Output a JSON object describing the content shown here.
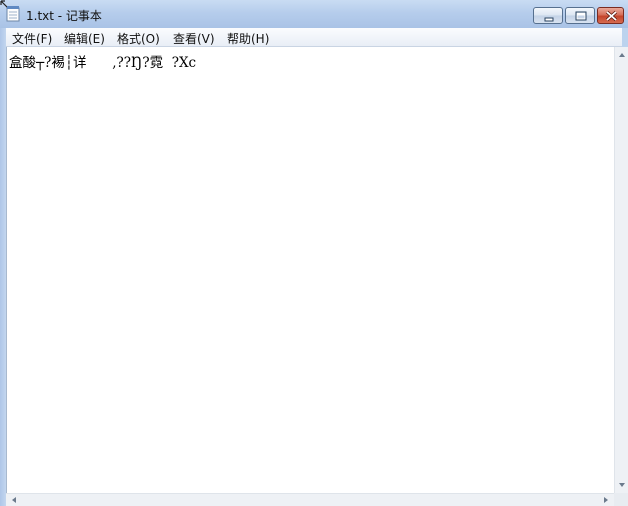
{
  "window": {
    "title": "1.txt - 记事本",
    "minimize_icon": "minimize-icon",
    "maximize_icon": "maximize-icon",
    "close_icon": "close-icon"
  },
  "menu": {
    "file": "文件(F)",
    "edit": "编辑(E)",
    "format": "格式(O)",
    "view": "查看(V)",
    "help": "帮助(H)"
  },
  "editor": {
    "content": "盒酸┬?裼┆详      ,??Ŋ?霓  ?Xc"
  },
  "colors": {
    "titlebar": "#b6cdec",
    "close_button": "#c4442b",
    "editor_background": "#ffffff"
  }
}
